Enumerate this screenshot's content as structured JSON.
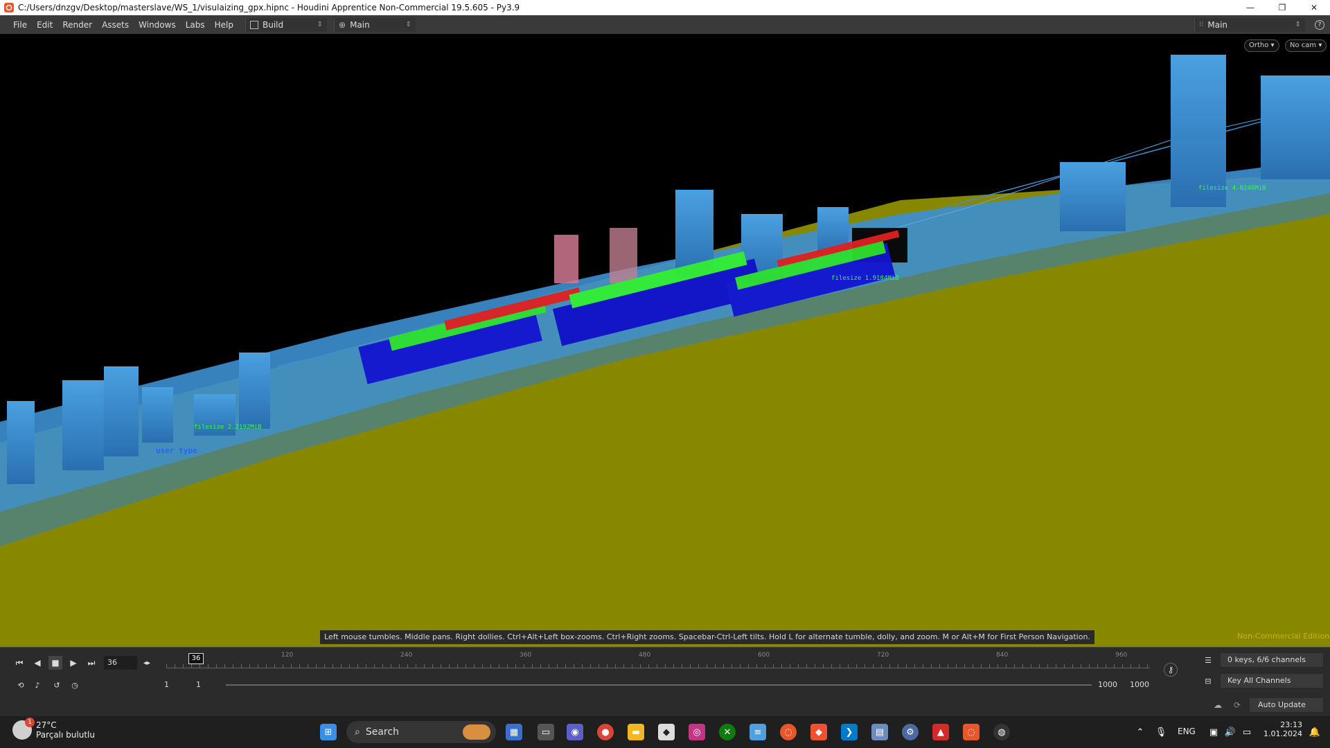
{
  "window": {
    "title": "C:/Users/dnzgv/Desktop/masterslave/WS_1/visulaizing_gpx.hipnc - Houdini Apprentice Non-Commercial 19.5.605 - Py3.9",
    "minimize": "—",
    "maximize": "❐",
    "close": "✕"
  },
  "menubar": {
    "items": [
      "File",
      "Edit",
      "Render",
      "Assets",
      "Windows",
      "Labs",
      "Help"
    ],
    "desktop_build": "Build",
    "desktop_main": "Main",
    "right_desktop": "Main"
  },
  "viewport": {
    "ortho_button": "Ortho ▾",
    "camera_button": "No cam ▾",
    "hint": "Left mouse tumbles. Middle pans. Right dollies. Ctrl+Alt+Left box-zooms. Ctrl+Right zooms. Spacebar-Ctrl-Left tilts. Hold L for alternate tumble, dolly, and zoom.    M or Alt+M for First Person Navigation.",
    "edition_label": "Non-Commercial Edition",
    "scene_labels": {
      "user_type": "user type",
      "file_size_1": "filesize 2.2192MiB",
      "file_size_2": "filesize 1.9184MiB",
      "file_size_3": "filesize 4.0246MiB"
    }
  },
  "timeline": {
    "current_frame": "36",
    "cursor_frame": "36",
    "tick_labels": [
      "120",
      "240",
      "360",
      "480",
      "600",
      "720",
      "840",
      "960"
    ],
    "start_frame": "1",
    "range_start": "1",
    "range_end": "1000",
    "end_frame": "1000",
    "keys_info": "0 keys, 6/6 channels",
    "key_all": "Key All Channels",
    "auto_update": "Auto Update"
  },
  "taskbar": {
    "weather_temp": "27°C",
    "weather_desc": "Parçalı bulutlu",
    "weather_badge": "1",
    "search_placeholder": "Search",
    "language": "ENG",
    "time": "23:13",
    "date": "1.01.2024"
  },
  "colors": {
    "ground": "#8a8800",
    "building_blue": "#3d8fd0",
    "label_green": "#33ff33",
    "label_red": "#ff3030",
    "label_blue": "#2040ff"
  }
}
